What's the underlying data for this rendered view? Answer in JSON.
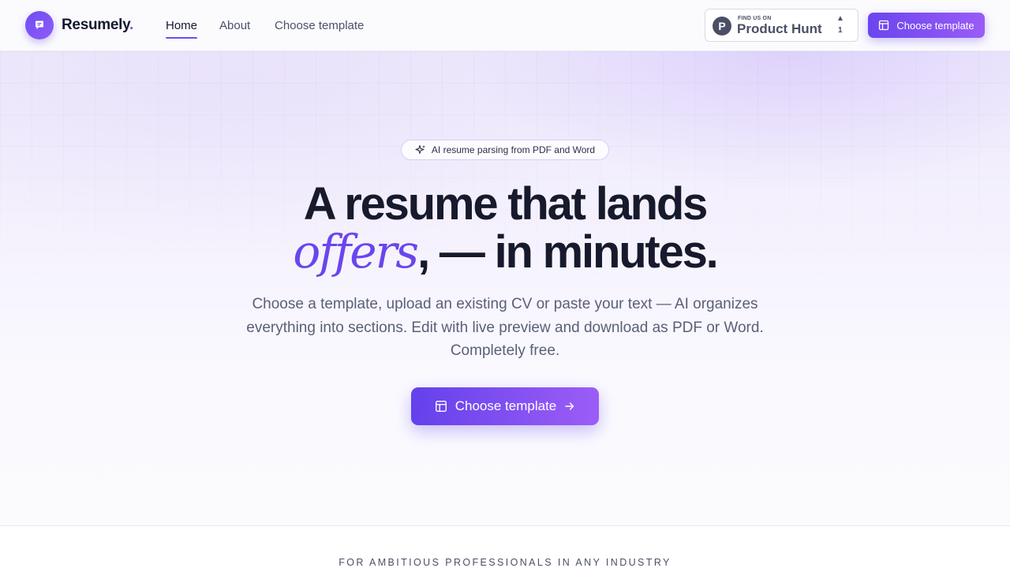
{
  "header": {
    "brand": "Resumely",
    "brand_dot": ".",
    "nav": [
      {
        "label": "Home",
        "active": true
      },
      {
        "label": "About",
        "active": false
      },
      {
        "label": "Choose template",
        "active": false
      }
    ],
    "product_hunt": {
      "small": "FIND US ON",
      "big": "Product Hunt",
      "letter": "P",
      "upvotes": "1"
    },
    "cta_label": "Choose template"
  },
  "hero": {
    "pill": "AI resume parsing from PDF and Word",
    "headline_line1": "A resume that lands",
    "headline_italic": "offers",
    "headline_rest": ", — in minutes.",
    "subtitle": "Choose a template, upload an existing CV or paste your text — AI organizes everything into sections. Edit with live preview and download as PDF or Word. Completely free.",
    "cta_label": "Choose template"
  },
  "tagline": "FOR AMBITIOUS PROFESSIONALS IN ANY INDUSTRY",
  "colors": {
    "accent": "#6d4df2",
    "accent_light": "#9a5cf6",
    "text_dark": "#161a2c",
    "text_muted": "#5a6078"
  },
  "icons": {
    "logo": "chat-bubble-icon",
    "pill": "sparkle-icon",
    "cta": "layout-template-icon",
    "cta_arrow": "arrow-right-icon"
  }
}
